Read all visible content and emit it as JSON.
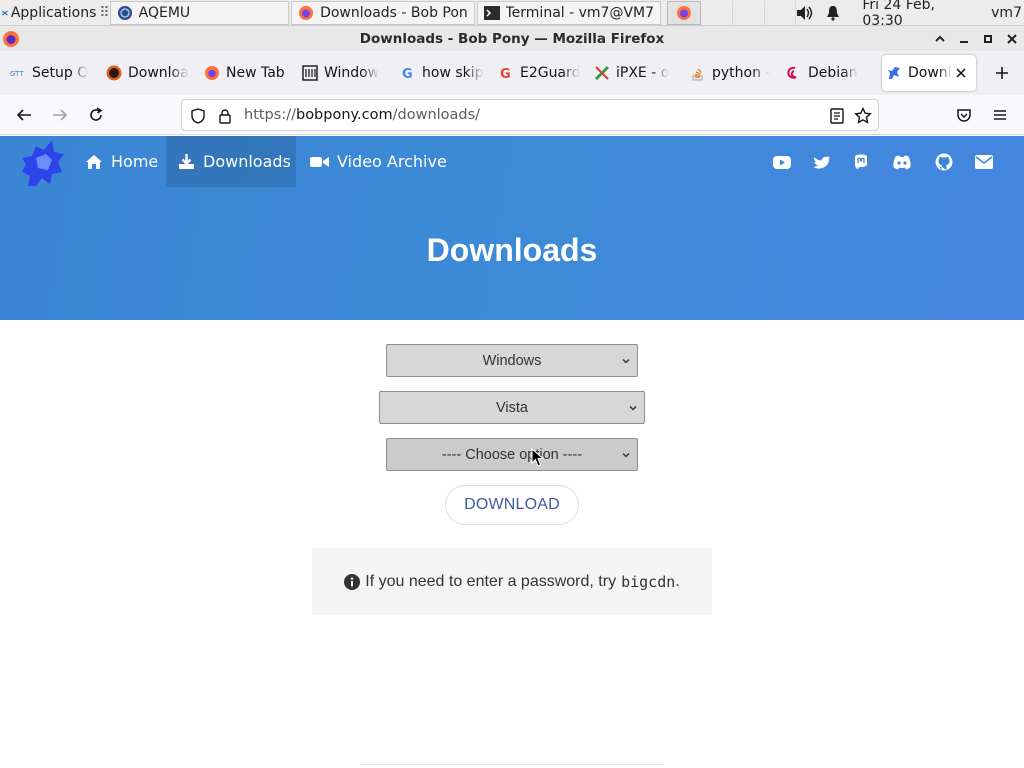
{
  "panel": {
    "applications_label": "Applications",
    "tasks": [
      {
        "title": "AQEMU"
      },
      {
        "title": "Downloads - Bob Pon..."
      },
      {
        "title": "Terminal - vm7@VM7..."
      }
    ],
    "clock": "Fri 24 Feb, 03:30",
    "user": "vm7"
  },
  "window": {
    "title": "Downloads - Bob Pony — Mozilla Firefox"
  },
  "tabs": [
    {
      "label": "Setup Q"
    },
    {
      "label": "Downloa"
    },
    {
      "label": "New Tab"
    },
    {
      "label": "Window"
    },
    {
      "label": "how skip"
    },
    {
      "label": "E2Guard"
    },
    {
      "label": "iPXE - o"
    },
    {
      "label": "python -"
    },
    {
      "label": "Debian"
    },
    {
      "label": "Downl"
    }
  ],
  "urlbar": {
    "scheme": "https://",
    "host": "bobpony.com",
    "path": "/downloads/"
  },
  "site": {
    "nav": {
      "home": "Home",
      "downloads": "Downloads",
      "video_archive": "Video Archive"
    },
    "page_title": "Downloads",
    "selects": {
      "os": "Windows",
      "version": "Vista",
      "option": "---- Choose option ----"
    },
    "download_label": "DOWNLOAD",
    "info": {
      "text": "If you need to enter a password, try",
      "code": "bigcdn",
      "end": "."
    }
  },
  "colors": {
    "header_blue": "#3a86d4",
    "download_text": "#3d5aa8"
  }
}
